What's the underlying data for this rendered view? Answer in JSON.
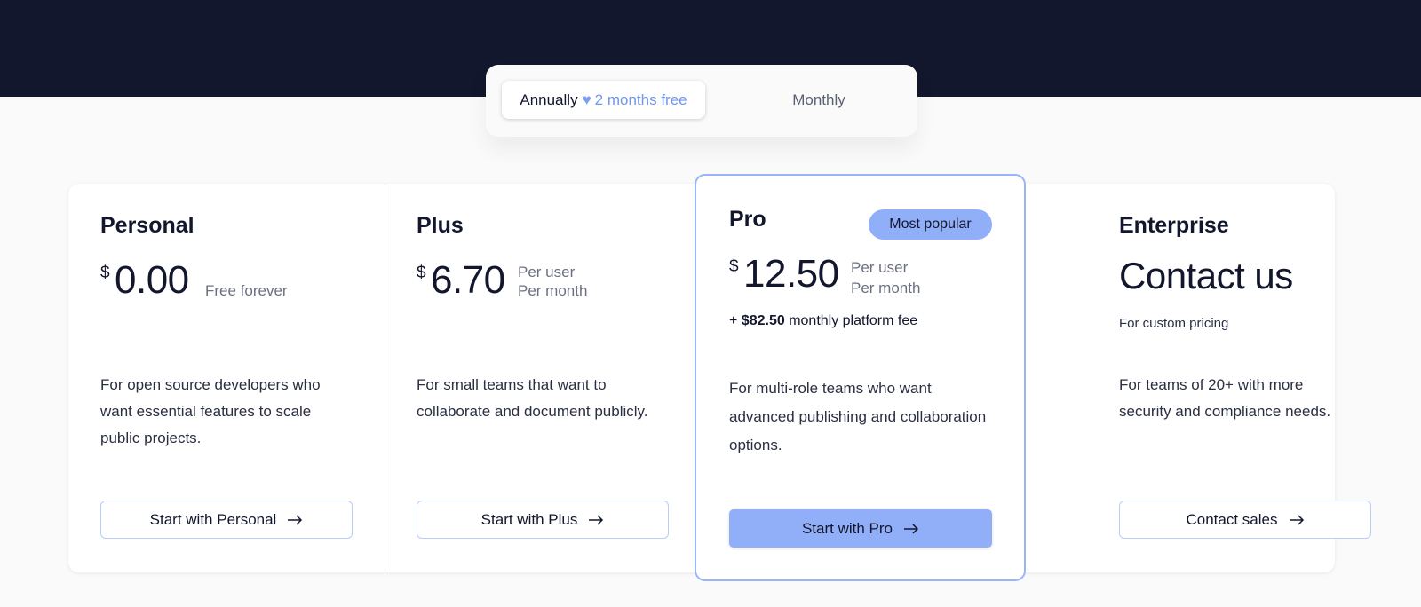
{
  "billing_toggle": {
    "annually_label": "Annually",
    "heart_icon": "heart-icon",
    "promo_text": "2 months free",
    "monthly_label": "Monthly"
  },
  "plans": [
    {
      "name": "Personal",
      "currency": "$",
      "price": "0.00",
      "note_line1": "Free forever",
      "description": "For open source developers who want essential features to scale public projects.",
      "cta": "Start with Personal"
    },
    {
      "name": "Plus",
      "currency": "$",
      "price": "6.70",
      "note_line1": "Per user",
      "note_line2": "Per month",
      "description": "For small teams that want to collaborate and document publicly.",
      "cta": "Start with Plus"
    },
    {
      "name": "Pro",
      "badge": "Most popular",
      "currency": "$",
      "price": "12.50",
      "note_line1": "Per user",
      "note_line2": "Per month",
      "fee_prefix": "+",
      "fee_amount": "$82.50",
      "fee_suffix": "monthly platform fee",
      "description": "For multi-role teams who want advanced publishing and collaboration options.",
      "cta": "Start with Pro"
    },
    {
      "name": "Enterprise",
      "price": "Contact us",
      "subtext": "For custom pricing",
      "description": "For teams of 20+ with more security and compliance needs.",
      "cta": "Contact sales"
    }
  ],
  "colors": {
    "navy": "#12172d",
    "accent_blue": "#91aff9",
    "border_blue": "#b9cdf7",
    "background": "#fafafa"
  }
}
